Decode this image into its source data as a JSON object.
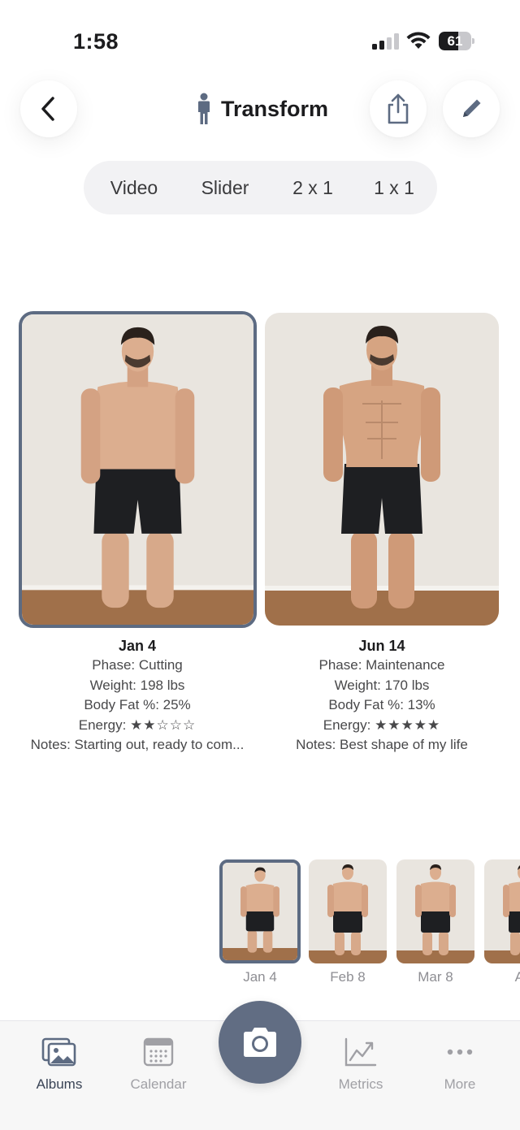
{
  "status_bar": {
    "time": "1:58",
    "battery": "61",
    "battery_level": 0.61
  },
  "header": {
    "title": "Transform"
  },
  "view_modes": {
    "video": "Video",
    "slider": "Slider",
    "two_by_one": "2 x 1",
    "one_by_one": "1 x 1",
    "selected": "2 x 1"
  },
  "comparison": {
    "left": {
      "date": "Jan 4",
      "phase": "Phase: Cutting",
      "weight": "Weight: 198 lbs",
      "body_fat": "Body Fat %: 25%",
      "energy_label": "Energy:",
      "energy_stars": "★★☆☆☆",
      "energy_rating": 2,
      "notes": "Notes: Starting out, ready to com..."
    },
    "right": {
      "date": "Jun 14",
      "phase": "Phase: Maintenance",
      "weight": "Weight: 170 lbs",
      "body_fat": "Body Fat %: 13%",
      "energy_label": "Energy:",
      "energy_stars": "★★★★★",
      "energy_rating": 5,
      "notes": "Notes: Best shape of my life"
    }
  },
  "thumbnails": [
    {
      "label": "Jan 4",
      "selected": true
    },
    {
      "label": "Feb 8",
      "selected": false
    },
    {
      "label": "Mar 8",
      "selected": false
    },
    {
      "label": "Ap",
      "selected": false
    }
  ],
  "tab_bar": {
    "albums": "Albums",
    "calendar": "Calendar",
    "metrics": "Metrics",
    "more": "More",
    "active": "Albums"
  },
  "colors": {
    "accent": "#616d83",
    "selection_border": "#5d6b82",
    "photo_wall": "#e9e5df",
    "floor": "#a0704a"
  }
}
